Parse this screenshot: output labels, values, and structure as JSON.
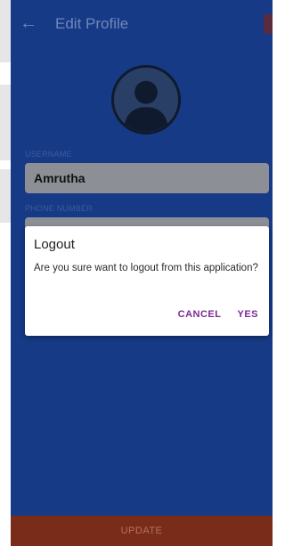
{
  "app_bar": {
    "title": "Edit Profile"
  },
  "form": {
    "username_label": "USERNAME",
    "username_value": "Amrutha",
    "phone_label": "PHONE NUMBER",
    "update_label": "UPDATE"
  },
  "dialog": {
    "title": "Logout",
    "message": "Are you sure want to logout from this application?",
    "cancel_label": "CANCEL",
    "yes_label": "YES"
  },
  "icons": [
    "back-arrow-icon",
    "profile-avatar-icon"
  ],
  "colors": {
    "primary": "#173a86",
    "accent": "#7b2a93",
    "update_bar": "#7a2c1a"
  }
}
